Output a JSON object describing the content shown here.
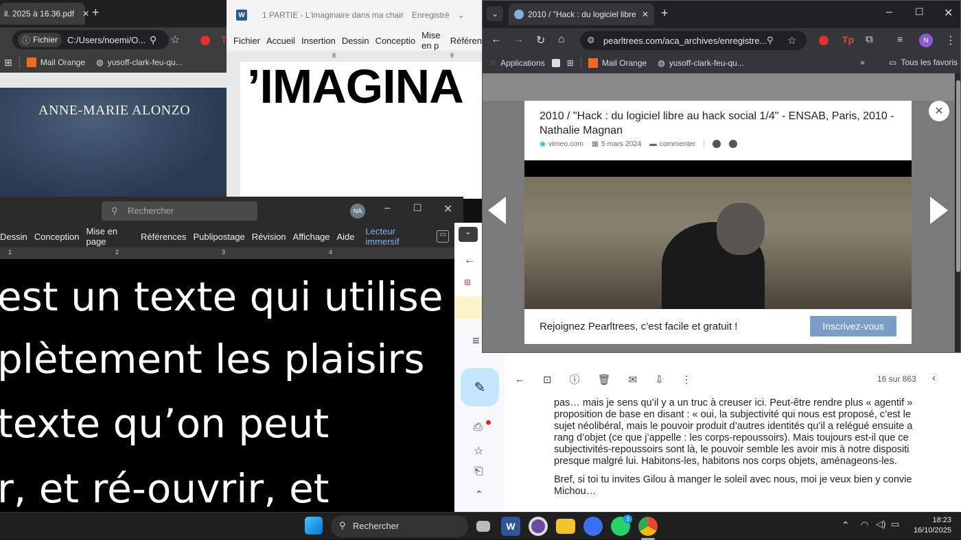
{
  "pdf_window": {
    "tab_title": "il. 2025 à 16.36.pdf",
    "address": "C:/Users/noemi/O...",
    "address_label": "Fichier",
    "bookmarks": [
      "Mail Orange",
      "yusoff-clark-feu-qu..."
    ],
    "cover_author": "ANNE-MARIE ALONZO"
  },
  "word_top": {
    "title": "1 PARTIE - L'imaginaire dans ma chair",
    "save_state": "Enregistré",
    "menu": [
      "Fichier",
      "Accueil",
      "Insertion",
      "Dessin",
      "Conceptio",
      "Mise en p",
      "Référen"
    ],
    "ruler": [
      "8",
      "9"
    ],
    "heading_text": "’IMAGINA"
  },
  "word_bottom": {
    "search_placeholder": "Rechercher",
    "user_initials": "NA",
    "menu": [
      "Dessin",
      "Conception",
      "Mise en page",
      "Références",
      "Publipostage",
      "Révision",
      "Affichage",
      "Aide"
    ],
    "reader_mode": "Lecteur immersif",
    "ruler": [
      "1",
      "1",
      "2",
      "3",
      "4"
    ],
    "lines": [
      "est un texte qui utilise",
      "plètement les plaisirs",
      "texte qu’on peut",
      "r, et ré-ouvrir, et"
    ]
  },
  "gmail": {
    "counter": "16 sur 863",
    "paragraph1": [
      "pas… mais je sens qu’il y a un truc à creuser ici. Peut-être rendre plus « agentif »",
      "proposition de base en disant : « oui, la subjectivité qui nous est proposé, c’est le",
      "sujet néolibéral, mais le pouvoir produit d’autres identités qu’il a relégué ensuite a",
      "rang d’objet (ce que j’appelle : les corps-repoussoirs). Mais toujours est-il que ce",
      "subjectivités-repoussoirs sont là, le pouvoir semble les avoir mis à notre dispositi",
      "presque malgré lui. Habitons-les, habitons nos corps objets, aménageons-les."
    ],
    "paragraph2": [
      "Bref, si toi tu invites Gilou à manger le soleil avec nous, moi je veux bien y convie",
      "Michou…"
    ]
  },
  "chrome": {
    "tab_title": "2010 / \"Hack : du logiciel libre a",
    "url": "pearltrees.com/aca_archives/enregistre...",
    "bookmarks": [
      "Applications",
      "Mail Orange",
      "yusoff-clark-feu-qu..."
    ],
    "all_bookmarks": "Tous les favoris",
    "profile_initial": "N",
    "modal": {
      "title": "2010 / \"Hack : du logiciel libre au hack social 1/4\" - ENSAB, Paris, 2010 - Nathalie Magnan",
      "source": "vimeo.com",
      "date": "5 mars 2024",
      "comment": "commenter",
      "join_text": "Rejoignez Pearltrees, c’est facile et gratuit !",
      "signup": "Inscrivez-vous"
    }
  },
  "taskbar": {
    "search": "Rechercher",
    "time": "18:23",
    "date": "16/10/2025",
    "whatsapp_badge": "3"
  }
}
